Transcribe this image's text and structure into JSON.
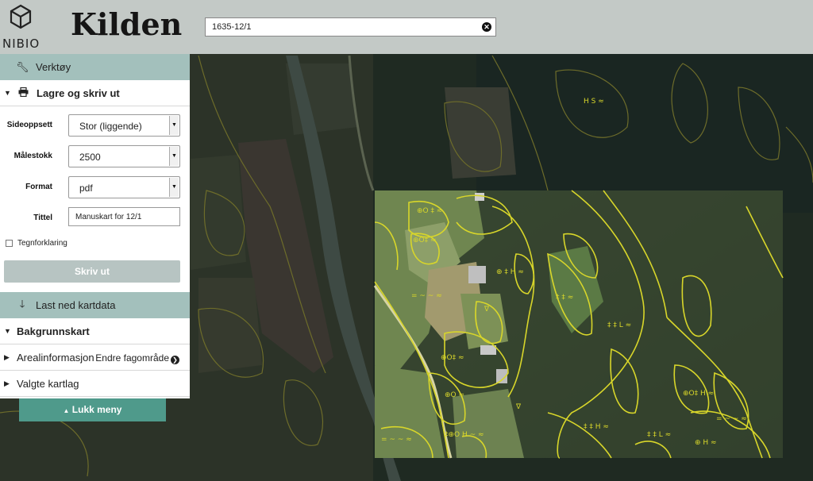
{
  "header": {
    "logo_text": "NIBIO",
    "app_title": "Kilden",
    "search_value": "1635-12/1"
  },
  "panel": {
    "tools_label": "Verktøy",
    "print_section": {
      "label": "Lagre og skriv ut",
      "page_setup_label": "Sideoppsett",
      "page_setup_value": "Stor (liggende)",
      "scale_label": "Målestokk",
      "scale_value": "2500",
      "format_label": "Format",
      "format_value": "pdf",
      "title_label": "Tittel",
      "title_value": "Manuskart for 12/1",
      "legend_label": "Tegnforklaring",
      "print_button": "Skriv ut"
    },
    "download_label": "Last ned kartdata",
    "background_label": "Bakgrunnskart",
    "area_info_label": "Arealinformasjon",
    "change_field_label": "Endre fagområde",
    "selected_layers_label": "Valgte kartlag",
    "close_menu_label": "Lukk meny"
  },
  "colors": {
    "header_bg": "#c3c9c6",
    "teal_bar": "#a3c0bc",
    "close_button": "#4f9a8b",
    "map_polygon": "#d8d62a"
  }
}
